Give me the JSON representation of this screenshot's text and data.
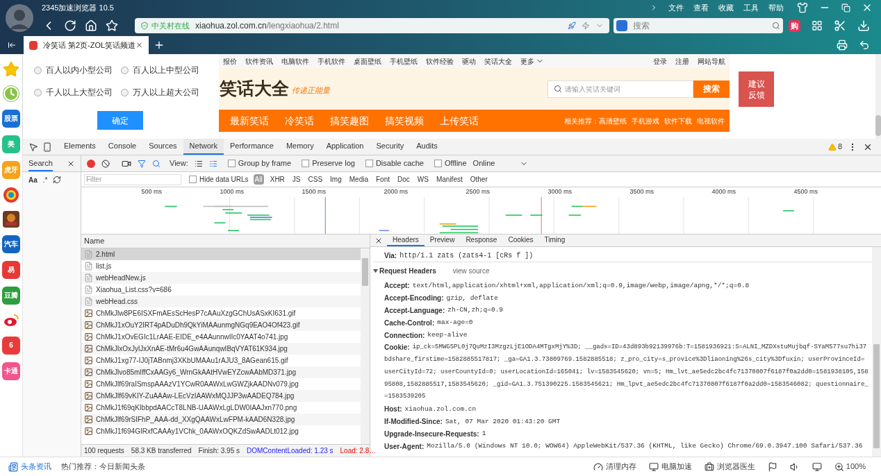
{
  "browser": {
    "title": "2345加速浏览器 10.5",
    "menu": [
      "文件",
      "查看",
      "收藏",
      "工具",
      "帮助"
    ],
    "address": {
      "badge": "中关村在线",
      "host": "xiaohua.zol.com.cn",
      "path": "/lengxiaohua/2.html"
    },
    "search": {
      "placeholder": "搜索"
    },
    "shop": "购",
    "tabs": [
      {
        "title": "冷笑话 第2页-ZOL笑话频道",
        "selected": true
      }
    ]
  },
  "sidebar": [
    {
      "kind": "star"
    },
    {
      "kind": "clock"
    },
    {
      "kind": "tile",
      "label": "股票",
      "color": "#1a6fd4"
    },
    {
      "kind": "tile",
      "label": "美",
      "color": "#27c28a"
    },
    {
      "kind": "tile",
      "label": "虎牙",
      "color": "#f7a21b"
    },
    {
      "kind": "ball"
    },
    {
      "kind": "game"
    },
    {
      "kind": "tile",
      "label": "汽车",
      "color": "#1565c0"
    },
    {
      "kind": "tile",
      "label": "易",
      "color": "#e53935"
    },
    {
      "kind": "tile",
      "label": "豆瓣",
      "color": "#2e9d3f"
    },
    {
      "kind": "weibo"
    },
    {
      "kind": "tile",
      "label": "6",
      "color": "#ea3b3b"
    },
    {
      "kind": "tile",
      "label": "卡通",
      "color": "#f0568c"
    }
  ],
  "popup": {
    "options": [
      {
        "label": "百人以内小型公司",
        "selected": false
      },
      {
        "label": "百人以上中型公司",
        "selected": false
      },
      {
        "label": "千人以上大型公司",
        "selected": false
      },
      {
        "label": "万人以上超大公司",
        "selected": false
      }
    ],
    "button": "确定"
  },
  "webpage": {
    "topnav": [
      "报价",
      "软件资讯",
      "电脑软件",
      "手机软件",
      "桌面壁纸",
      "手机壁纸",
      "软件经验",
      "驱动",
      "笑话大全",
      "更多"
    ],
    "account": [
      "登录",
      "注册",
      "网站导航"
    ],
    "logo": "笑话大全",
    "slogan": "传递正能量",
    "search": {
      "placeholder": "请输入笑话关键词",
      "button": "搜索"
    },
    "feedback": "建议反馈",
    "channels": [
      "最新笑话",
      "冷笑话",
      "搞笑趣图",
      "搞笑视频",
      "上传笑话"
    ],
    "related_label": "相关推荐：",
    "related": [
      "高清壁纸",
      "手机游戏",
      "软件下载",
      "电视软件"
    ]
  },
  "devtools": {
    "tabs": [
      {
        "label": "Elements",
        "selected": false
      },
      {
        "label": "Console",
        "selected": false
      },
      {
        "label": "Sources",
        "selected": false
      },
      {
        "label": "Network",
        "selected": true
      },
      {
        "label": "Performance",
        "selected": false
      },
      {
        "label": "Memory",
        "selected": false
      },
      {
        "label": "Application",
        "selected": false
      },
      {
        "label": "Security",
        "selected": false
      },
      {
        "label": "Audits",
        "selected": false
      }
    ],
    "warnings": "8",
    "search_panel": {
      "title": "Search",
      "case": "Aa",
      "regex": ".*"
    },
    "recording": true,
    "view_label": "View:",
    "options": [
      {
        "label": "Group by frame",
        "checked": false
      },
      {
        "label": "Preserve log",
        "checked": false
      },
      {
        "label": "Disable cache",
        "checked": false
      },
      {
        "label": "Offline",
        "checked": false
      }
    ],
    "throttle": "Online",
    "filter": {
      "placeholder": "Filter",
      "hide_data_urls": {
        "label": "Hide data URLs",
        "checked": false
      },
      "types": [
        {
          "label": "All",
          "selected": true
        },
        {
          "label": "XHR",
          "selected": false
        },
        {
          "label": "JS",
          "selected": false
        },
        {
          "label": "CSS",
          "selected": false
        },
        {
          "label": "Img",
          "selected": false
        },
        {
          "label": "Media",
          "selected": false
        },
        {
          "label": "Font",
          "selected": false
        },
        {
          "label": "Doc",
          "selected": false
        },
        {
          "label": "WS",
          "selected": false
        },
        {
          "label": "Manifest",
          "selected": false
        },
        {
          "label": "Other",
          "selected": false
        }
      ]
    },
    "timeline_ticks": [
      "500 ms",
      "1000 ms",
      "1500 ms",
      "2000 ms",
      "2500 ms",
      "3000 ms",
      "3500 ms",
      "4000 ms",
      "4500 ms"
    ],
    "requests": {
      "column": "Name",
      "rows": [
        {
          "name": "2.html",
          "kind": "doc",
          "selected": true
        },
        {
          "name": "list.js",
          "kind": "doc",
          "selected": false
        },
        {
          "name": "webHeadNew.js",
          "kind": "doc",
          "selected": false
        },
        {
          "name": "Xiaohua_List.css?v=686",
          "kind": "doc",
          "selected": false
        },
        {
          "name": "webHead.css",
          "kind": "doc",
          "selected": false
        },
        {
          "name": "ChMkJlw8PE6ISXFmAEsScHesP7cAAuXzgGChUsASxKI631.gif",
          "kind": "image",
          "selected": false
        },
        {
          "name": "ChMkJ1xOuY2IRT4pADuDh9QkYiMAAunmgNGq9EAO4Of423.gif",
          "kind": "image",
          "selected": false
        },
        {
          "name": "ChMkJ1xOvEGIc1LrAAE-EIDE_e4AAunnwIIc0YAAT4o741.jpg",
          "kind": "image",
          "selected": false
        },
        {
          "name": "ChMkJlxOxJylJxXnAE-tMr6u4GwAAunqwIBqVYAT61K934.jpg",
          "kind": "image",
          "selected": false
        },
        {
          "name": "ChMkJ1xg77-IJ0jTABnmj3XKbUMAAu1rAJU3_8AGean615.gif",
          "kind": "image",
          "selected": false
        },
        {
          "name": "ChMkJlvo85mIffCxAAGy6_WrnGkAAtHVwEYZcwAAbMD371.jpg",
          "kind": "image",
          "selected": false
        },
        {
          "name": "ChMkJlf69raISmspAAAzV1YCwR0AAWxLwGWZjkAADNv079.jpg",
          "kind": "image",
          "selected": false
        },
        {
          "name": "ChMkJlf69vKIY-ZuAAAw-LEcVzIAAWxMQJJP3wAADEQ784.jpg",
          "kind": "image",
          "selected": false
        },
        {
          "name": "ChMkJ1f69qKIbbpdAACcT8LNB-UAAWxLgLDW0IAAJxn770.png",
          "kind": "image",
          "selected": false
        },
        {
          "name": "ChMkJlf69rSIFhP_AAA-dd_XXgQAAWxLwFPM-kAAD6N328.jpg",
          "kind": "image",
          "selected": false
        },
        {
          "name": "ChMkJ1f694GIRxfCAAAy1VChk_0AAWxOQKZdSwAADLt012.jpg",
          "kind": "image",
          "selected": false
        }
      ]
    },
    "summary": [
      "100 requests",
      "58.3 KB transferred",
      "Finish: 3.95 s"
    ],
    "dom_content_loaded": "DOMContentLoaded: 1.23 s",
    "load": "Load: 2.8…",
    "detail_tabs": [
      {
        "label": "Headers",
        "selected": true
      },
      {
        "label": "Preview",
        "selected": false
      },
      {
        "label": "Response",
        "selected": false
      },
      {
        "label": "Cookies",
        "selected": false
      },
      {
        "label": "Timing",
        "selected": false
      }
    ],
    "via": {
      "name": "Via:",
      "value": "http/1.1 zats (zats4-1 [cRs f ])"
    },
    "request_headers": {
      "title": "Request Headers",
      "expanded": true,
      "view_source": "view source",
      "items": [
        {
          "name": "Accept:",
          "lines": [
            "text/html,application/xhtml+xml,application/xml;q=0.9,image/webp,image/apng,*/*;q=0.8"
          ]
        },
        {
          "name": "Accept-Encoding:",
          "lines": [
            "gzip, deflate"
          ]
        },
        {
          "name": "Accept-Language:",
          "lines": [
            "zh-CN,zh;q=0.9"
          ]
        },
        {
          "name": "Cache-Control:",
          "lines": [
            "max-age=0"
          ]
        },
        {
          "name": "Connection:",
          "lines": [
            "keep-alive"
          ]
        },
        {
          "name": "Cookie:",
          "lines": [
            "ip_ck=5MWG5PL0j7QuMzI3MzgzLjE1ODA4MTgxMjY%3D; __gads=ID=43d893b92139976b:T=1581936921:S=ALNI_MZDXstuMujbqf-SYaM577su7hi37",
            "bdshare_firstime=1582885517817; _ga=GA1.3.73809769.1582885518; z_pro_city=s_provice%3Dliaoning%26s_city%3Dfuxin; userProvinceId=",
            "userCityId=72; userCountyId=0; userLocationId=165041; lv=1583545620; vn=5; Hm_lvt_ae5edc2bc4fc71370807f6187f0a2dd0=1581938105,158",
            "95808,1582885517,1583545620; _gid=GA1.3.751390225.1583545621; Hm_lpvt_ae5edc2bc4fc71370807f6187f0a2dd0=1583546082; questionnaire_",
            "=1583539205"
          ]
        },
        {
          "name": "Host:",
          "lines": [
            "xiaohua.zol.com.cn"
          ]
        },
        {
          "name": "If-Modified-Since:",
          "lines": [
            "Sat, 07 Mar 2020 01:43:20 GMT"
          ]
        },
        {
          "name": "Upgrade-Insecure-Requests:",
          "lines": [
            "1"
          ]
        },
        {
          "name": "User-Agent:",
          "lines": [
            "Mozilla/5.0 (Windows NT 10.0; WOW64) AppleWebKit/537.36 (KHTML, like Gecko) Chrome/69.0.3947.100 Safari/537.36"
          ]
        }
      ]
    }
  },
  "status": {
    "news": "头条资讯",
    "hot": "热门推荐：今日新闻头条",
    "tools": [
      "清理内存",
      "电脑加速",
      "浏览器医生"
    ],
    "zoom": "100%"
  }
}
